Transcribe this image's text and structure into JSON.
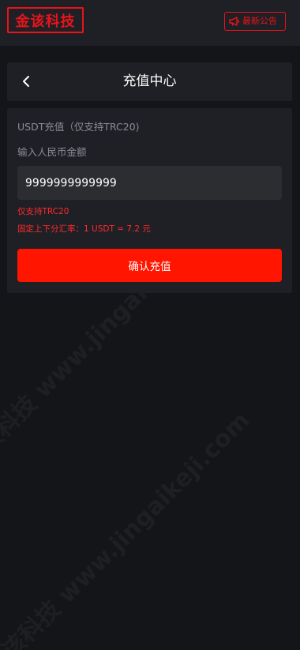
{
  "brand": {
    "logo_text": "金该科技",
    "accent_color": "#e8141a"
  },
  "topbar": {
    "notice_label": "最新公告",
    "notice_icon": "megaphone-icon"
  },
  "header": {
    "title": "充值中心",
    "back_icon": "chevron-left-icon"
  },
  "form": {
    "subtitle": "USDT充值（仅支持TRC20)",
    "amount_label": "输入人民币金额",
    "amount_value": "9999999999999",
    "hint_network": "仅支持TRC20",
    "hint_rate": "固定上下分汇率：1 USDT = 7.2 元",
    "confirm_label": "确认充值",
    "confirm_color": "#ff1500"
  },
  "watermark": {
    "text": "金该科技 www.jingaikeji.com"
  }
}
